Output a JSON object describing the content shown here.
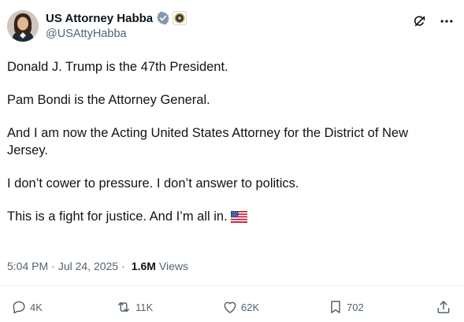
{
  "author": {
    "display_name": "US Attorney Habba",
    "handle": "@USAttyHabba",
    "verified_icon": "verified-badge-gray",
    "affiliation_icon": "doj-seal"
  },
  "post": {
    "paragraphs": [
      "Donald J. Trump is the 47th President.",
      "Pam Bondi is the Attorney General.",
      "And I am now the Acting United States Attorney for the District of New Jersey.",
      "I don’t cower to pressure. I don’t answer to politics.",
      "This is a fight for justice. And I’m all in."
    ],
    "emoji": "us-flag"
  },
  "meta": {
    "time": "5:04 PM",
    "separator": "·",
    "date": "Jul 24, 2025",
    "views_count": "1.6M",
    "views_label": "Views"
  },
  "actions": {
    "reply_count": "4K",
    "repost_count": "11K",
    "like_count": "62K",
    "bookmark_count": "702"
  },
  "colors": {
    "text": "#0f1419",
    "secondary": "#536471",
    "divider": "#eff3f4"
  }
}
